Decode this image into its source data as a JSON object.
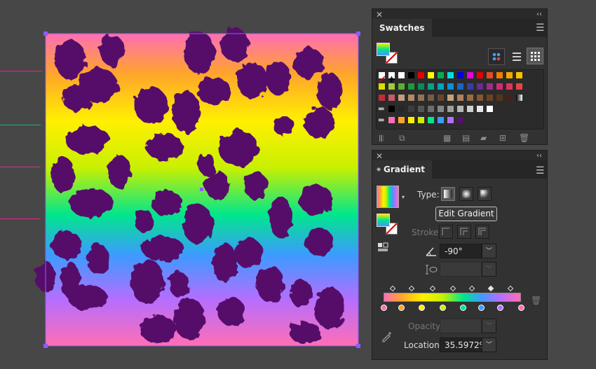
{
  "colors": {
    "spot": "#56106b",
    "gradient_stops": [
      "#ff6eb4",
      "#ffa52a",
      "#fff000",
      "#c8f000",
      "#00e68c",
      "#3c9bff",
      "#b46eff",
      "#ff6eb4"
    ]
  },
  "swatches": {
    "title": "Swatches",
    "icons": [
      "close-icon",
      "collapse-icon",
      "panel-menu-icon",
      "fill-stroke-icon",
      "color-group-icon",
      "list-view-icon",
      "grid-view-icon",
      "swatch-libraries-icon",
      "place-swatches-icon",
      "swatch-kind-icon",
      "swatch-options-icon",
      "new-group-icon",
      "new-swatch-icon",
      "delete-icon"
    ],
    "rows": [
      [
        "none",
        "register",
        "#ffffff",
        "#000000",
        "#e60000",
        "#ffff00",
        "#00b050",
        "#00e0e0",
        "#0000e6",
        "#e600e6",
        "#e60000",
        "#e84a1c",
        "#ef7d00",
        "#f5a800",
        "#f7c200"
      ],
      [
        "#d8e000",
        "#9fcc3a",
        "#58b033",
        "#1d9a3a",
        "#0a8a58",
        "#00a389",
        "#00a3c0",
        "#0b8fd8",
        "#1b64c8",
        "#3b3ca3",
        "#6c2a91",
        "#a02b8c",
        "#d02b76",
        "#e3335a",
        "#e64541"
      ],
      [
        "#c32a3c",
        "#c65a6a",
        "#c29c80",
        "#b08a66",
        "#927354",
        "#765c44",
        "#6a4430",
        "#c7a27a",
        "#b0825a",
        "#9b6b42",
        "#86562f",
        "#6e4221",
        "#5a331a",
        "#442414",
        "grad"
      ],
      [
        "folder",
        "#000000",
        "#262626",
        "#3d3d3d",
        "#555555",
        "#6d6d6d",
        "#868686",
        "#9e9e9e",
        "#b7b7b7",
        "#d0d0d0",
        "#e8e8e8",
        "#ffffff"
      ],
      [
        "folder",
        "#ff6eb4",
        "#ffa52a",
        "#fff000",
        "#c8f000",
        "#00e68c",
        "#3c9bff",
        "#b46eff",
        "#56106b"
      ]
    ]
  },
  "gradient": {
    "title": "Gradient",
    "icons": [
      "close-icon",
      "collapse-icon",
      "panel-menu-icon",
      "gradient-thumbnail-icon",
      "dropdown-icon",
      "linear-gradient-icon",
      "radial-gradient-icon",
      "freeform-gradient-icon",
      "fill-stroke-icon",
      "reverse-gradient-icon",
      "stroke-within-icon",
      "stroke-along-icon",
      "stroke-across-icon",
      "angle-icon",
      "aspect-ratio-icon",
      "delete-stop-icon",
      "eyedropper-icon",
      "dropdown-icon"
    ],
    "type_label": "Type:",
    "edit_button": "Edit Gradient",
    "stroke_label": "Stroke:",
    "angle_value": "-90°",
    "opacity_label": "Opacity:",
    "location_label": "Location:",
    "location_value": "35.5972%",
    "stop_locations": [
      0,
      13,
      28,
      43,
      58,
      71,
      85,
      100
    ],
    "midpoint_locations": [
      6.5,
      20.5,
      35.5,
      50.5,
      64.5,
      78,
      92.5
    ],
    "selected_midpoint": 5
  }
}
